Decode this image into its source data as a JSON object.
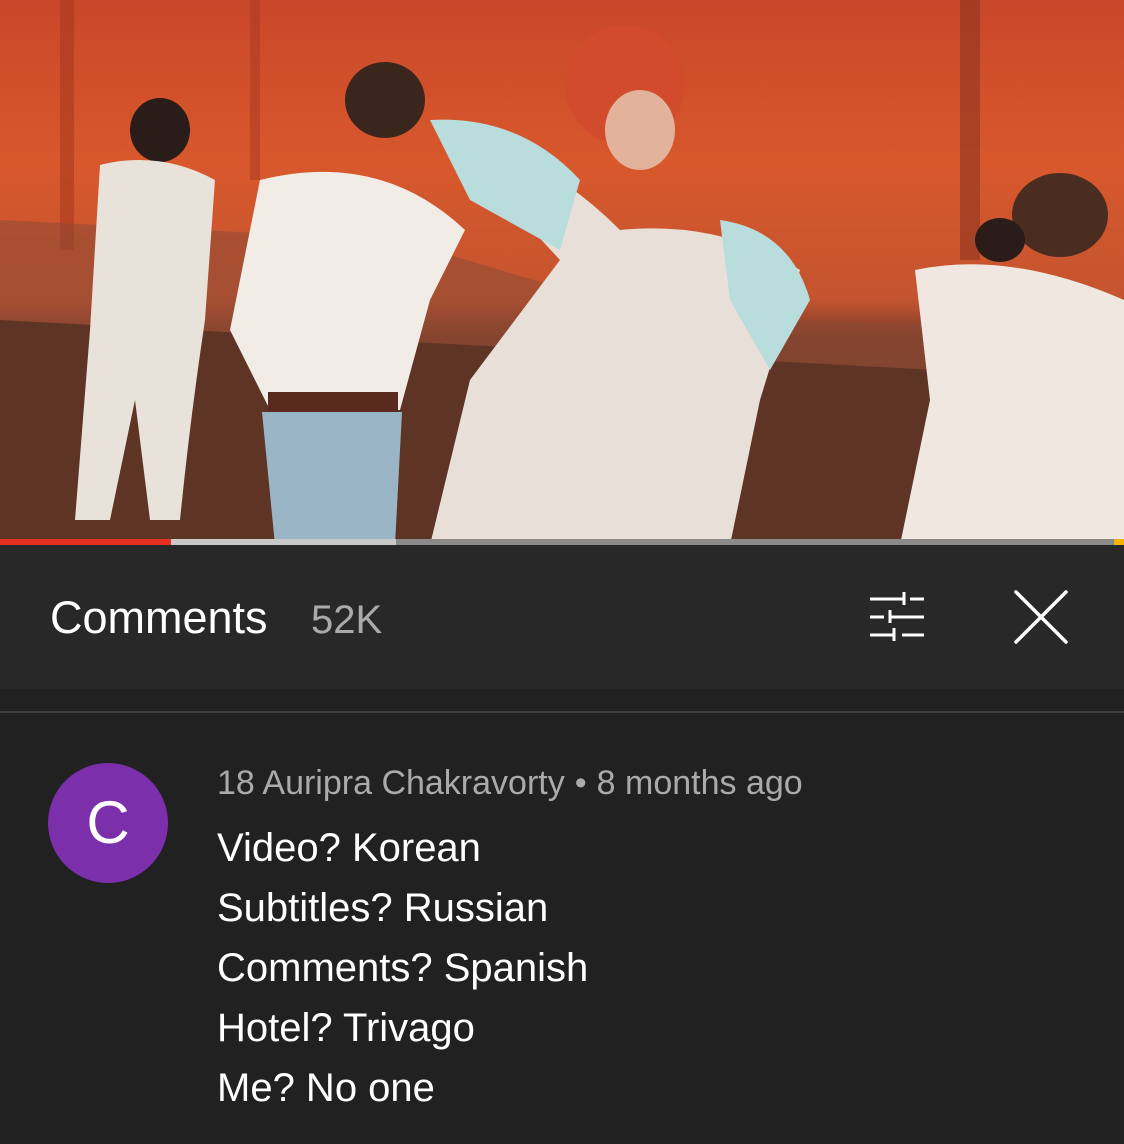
{
  "video": {
    "progress_played_fraction": 0.152,
    "progress_buffered_fraction": 0.352
  },
  "comments_panel": {
    "title": "Comments",
    "count": "52K",
    "filter_icon": "sort-filter-icon",
    "close_icon": "close-icon"
  },
  "comments": [
    {
      "avatar_letter": "C",
      "avatar_color": "#7b2fab",
      "author": "18 Auripra Chakravorty",
      "separator": "•",
      "time": "8 months ago",
      "lines": [
        "Video? Korean",
        "Subtitles? Russian",
        "Comments? Spanish",
        "Hotel? Trivago",
        "Me? No one"
      ]
    }
  ]
}
